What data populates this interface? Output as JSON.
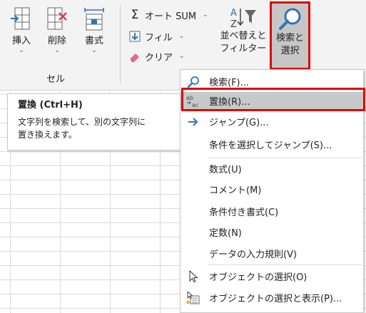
{
  "ribbon": {
    "insert": {
      "label": "挿入",
      "icon": "insert-cells-icon"
    },
    "delete": {
      "label": "削除",
      "icon": "delete-cells-icon"
    },
    "format": {
      "label": "書式",
      "icon": "format-cells-icon"
    },
    "cells_group_label": "セル",
    "autosum": {
      "label": "オート SUM",
      "icon": "sigma-icon"
    },
    "fill": {
      "label": "フィル",
      "icon": "fill-down-icon"
    },
    "clear": {
      "label": "クリア",
      "icon": "eraser-icon"
    },
    "sort_filter": {
      "line1": "並べ替えと",
      "line2": "フィルター",
      "icon": "sort-filter-icon"
    },
    "find_select": {
      "line1": "検索と",
      "line2": "選択",
      "icon": "magnifier-icon"
    },
    "chevron": "⌄"
  },
  "tooltip": {
    "title": "置換 (Ctrl+H)",
    "body_line1": "文字列を検索して、別の文字列に",
    "body_line2": "置き換えます。"
  },
  "menu": {
    "items": [
      {
        "label": "検索(F)...",
        "icon": "search-icon"
      },
      {
        "label": "置換(R)...",
        "icon": "replace-icon",
        "selected": true
      },
      {
        "label": "ジャンプ(G)...",
        "icon": "arrow-right-icon"
      },
      {
        "label": "条件を選択してジャンプ(S)..."
      },
      {
        "label": "数式(U)"
      },
      {
        "label": "コメント(M)"
      },
      {
        "label": "条件付き書式(C)"
      },
      {
        "label": "定数(N)"
      },
      {
        "label": "データの入力規則(V)"
      },
      {
        "label": "オブジェクトの選択(O)",
        "icon": "pointer-icon"
      },
      {
        "label": "オブジェクトの選択と表示(P)...",
        "icon": "selection-pane-icon"
      }
    ]
  },
  "colors": {
    "highlight_border": "#e00000",
    "accent_blue": "#2e75b6",
    "selected_bg": "#c8c8c8"
  }
}
